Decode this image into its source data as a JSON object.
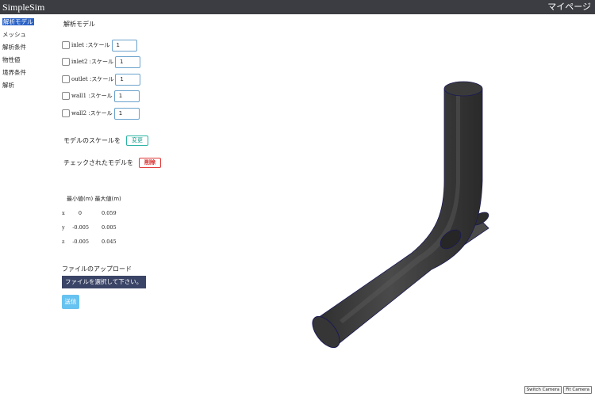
{
  "header": {
    "brand": "SimpleSim",
    "mypage": "マイページ"
  },
  "sidebar": {
    "items": [
      {
        "label": "解析モデル",
        "active": true
      },
      {
        "label": "メッシュ"
      },
      {
        "label": "解析条件"
      },
      {
        "label": "物性値"
      },
      {
        "label": "境界条件"
      },
      {
        "label": "解析"
      }
    ]
  },
  "model_panel": {
    "title": "解析モデル",
    "scale_suffix": ":スケール",
    "models": [
      {
        "name": "inlet ",
        "scale": "1"
      },
      {
        "name": "inlet2 ",
        "scale": "1"
      },
      {
        "name": "outlet ",
        "scale": "1"
      },
      {
        "name": "wall1 ",
        "scale": "1"
      },
      {
        "name": "wall2 ",
        "scale": "1"
      }
    ],
    "scale_text": "モデルのスケールを",
    "change_label": "変更",
    "delete_text": "チェックされたモデルを",
    "delete_label": "削除"
  },
  "bounds": {
    "header": "最小値(m) 最大値(m)",
    "rows": [
      {
        "axis": "x",
        "min": "0",
        "max": "0.059"
      },
      {
        "axis": "y",
        "min": "-0.005",
        "max": "0.005"
      },
      {
        "axis": "z",
        "min": "-0.005",
        "max": "0.045"
      }
    ]
  },
  "upload": {
    "title": "ファイルのアップロード",
    "file_button": "ファイルを選択して下さい。",
    "submit": "送信"
  },
  "viewport": {
    "switch_camera": "Switch Camera",
    "fit_camera": "Fit Camera",
    "pipe_color": "#3e3e3e",
    "edge_color": "#1a1a55"
  }
}
